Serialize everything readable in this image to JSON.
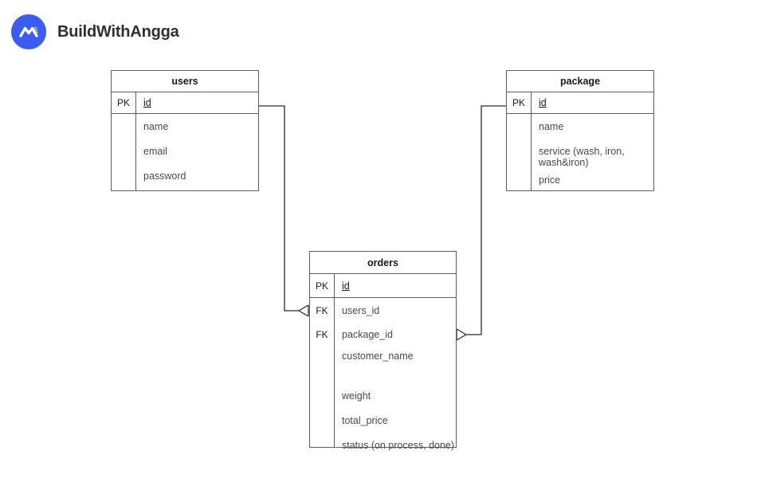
{
  "brand": {
    "name": "BuildWithAngga",
    "logo_icon": "buildwithangga-mountain-logo",
    "logo_color": "#3b5bf5",
    "text_color": "#2b2f3a"
  },
  "diagram": {
    "type": "entity-relationship-diagram",
    "line_color": "#5f5f5f",
    "entities": [
      {
        "id": "users",
        "title": "users",
        "key_rows": [
          {
            "key": "PK",
            "field": "id",
            "underline": true
          }
        ],
        "fields": [
          "name",
          "email",
          "password"
        ]
      },
      {
        "id": "package",
        "title": "package",
        "key_rows": [
          {
            "key": "PK",
            "field": "id",
            "underline": true
          }
        ],
        "fields": [
          "name",
          "service (wash, iron, wash&iron)",
          "price"
        ]
      },
      {
        "id": "orders",
        "title": "orders",
        "key_rows": [
          {
            "key": "PK",
            "field": "id",
            "underline": true
          },
          {
            "key": "FK",
            "field": "users_id",
            "underline": false
          },
          {
            "key": "FK",
            "field": "package_id",
            "underline": false
          }
        ],
        "fields": [
          "customer_name",
          "weight",
          "total_price",
          "status (on process, done)"
        ]
      }
    ],
    "relationships": [
      {
        "id": "users-orders",
        "from": "users.id",
        "to": "orders.users_id",
        "from_cardinality": "one",
        "to_cardinality": "many",
        "marker": "crows-foot"
      },
      {
        "id": "package-orders",
        "from": "package.id",
        "to": "orders.package_id",
        "from_cardinality": "one",
        "to_cardinality": "many",
        "marker": "crows-foot"
      }
    ]
  }
}
